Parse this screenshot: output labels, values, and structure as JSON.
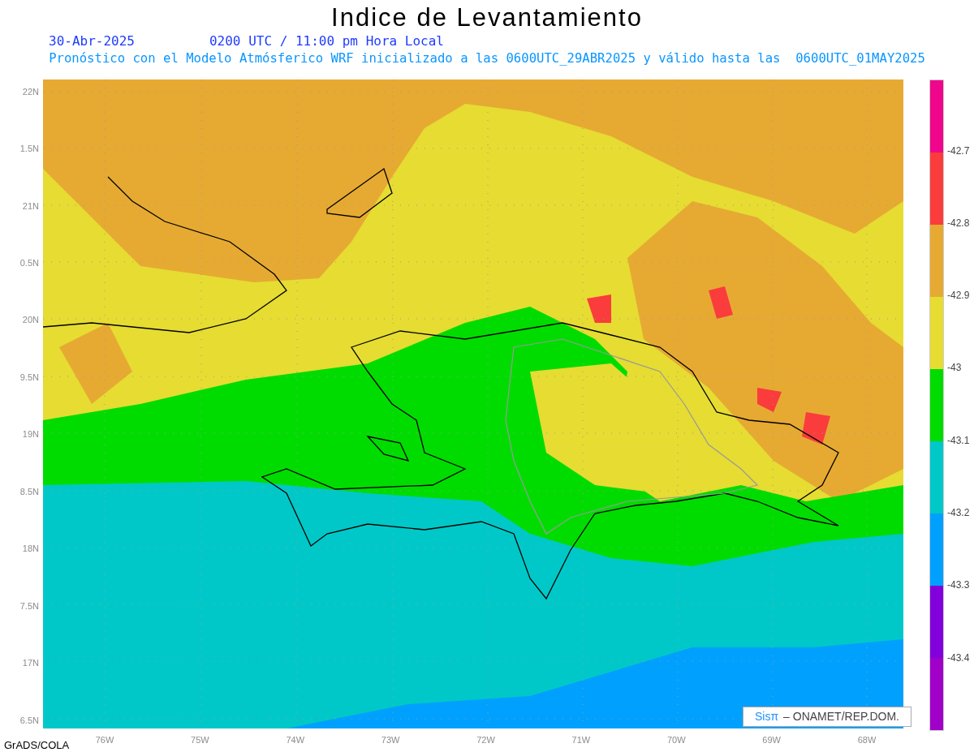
{
  "title": "Indice de Levantamiento",
  "date": "30-Abr-2025",
  "time": "0200 UTC / 11:00 pm Hora Local",
  "description": "Pronóstico con el Modelo Atmósferico WRF inicializado a las 0600UTC_29ABR2025 y válido hasta las  0600UTC_01MAY2025",
  "y_axis_labels": [
    "22N",
    "1.5N",
    "21N",
    "0.5N",
    "20N",
    "9.5N",
    "19N",
    "8.5N",
    "18N",
    "7.5N",
    "17N",
    "6.5N"
  ],
  "x_axis_labels": [
    "76W",
    "75W",
    "74W",
    "73W",
    "72W",
    "71W",
    "70W",
    "69W",
    "68W"
  ],
  "colorbar": {
    "bins": [
      {
        "color": "#f0068c"
      },
      {
        "color": "#fa3c3c"
      },
      {
        "color": "#e6aa32"
      },
      {
        "color": "#e6dc32"
      },
      {
        "color": "#00dc00"
      },
      {
        "color": "#00c8c8"
      },
      {
        "color": "#00a0ff"
      },
      {
        "color": "#8200dc"
      },
      {
        "color": "#a000c8"
      }
    ],
    "labels": [
      "-42.7",
      "-42.8",
      "-42.9",
      "-43",
      "-43.1",
      "-43.2",
      "-43.3",
      "-43.4"
    ]
  },
  "credit": {
    "brand": "Sisπ",
    "text": "– ONAMET/REP.DOM."
  },
  "footer": "GrADS/COLA"
}
